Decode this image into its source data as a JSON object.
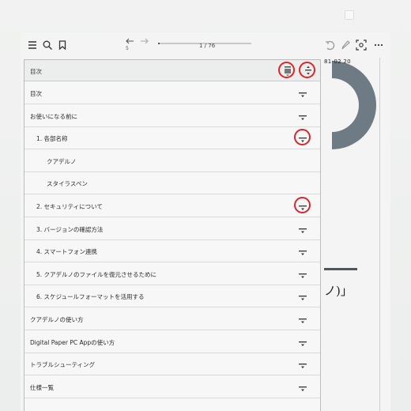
{
  "toolbar": {
    "page_indicator": "1 / 76",
    "nav_back_number": "5",
    "progress_fraction": 0.02,
    "icons": [
      "menu-icon",
      "search-icon",
      "bookmark-icon",
      "back-icon",
      "forward-icon",
      "undo-icon",
      "pen-icon",
      "screenshot-icon",
      "more-icon"
    ]
  },
  "document": {
    "date": "81-02 20",
    "text_fragment": "ノ)」"
  },
  "toc": {
    "title": "目次",
    "items": [
      {
        "label": "目次",
        "indent": 0
      },
      {
        "label": "お使いになる前に",
        "indent": 0
      },
      {
        "label": "1. 各部名称",
        "indent": 1
      },
      {
        "label": "クアデルノ",
        "indent": 2
      },
      {
        "label": "スタイラスペン",
        "indent": 2
      },
      {
        "label": "2. セキュリティについて",
        "indent": 1
      },
      {
        "label": "3. バージョンの確認方法",
        "indent": 1
      },
      {
        "label": "4. スマートフォン連携",
        "indent": 1
      },
      {
        "label": "5. クアデルノのファイルを復元させるために",
        "indent": 1
      },
      {
        "label": "6. スケジュールフォーマットを活用する",
        "indent": 1
      },
      {
        "label": "クアデルノの使い方",
        "indent": 0
      },
      {
        "label": "Digital Paper PC Appの使い方",
        "indent": 0
      },
      {
        "label": "トラブルシューティング",
        "indent": 0
      },
      {
        "label": "仕様一覧",
        "indent": 0
      }
    ]
  },
  "colors": {
    "highlight_ring": "#d9262c",
    "frame": "#eceeed",
    "screen": "#f3f4f3"
  }
}
